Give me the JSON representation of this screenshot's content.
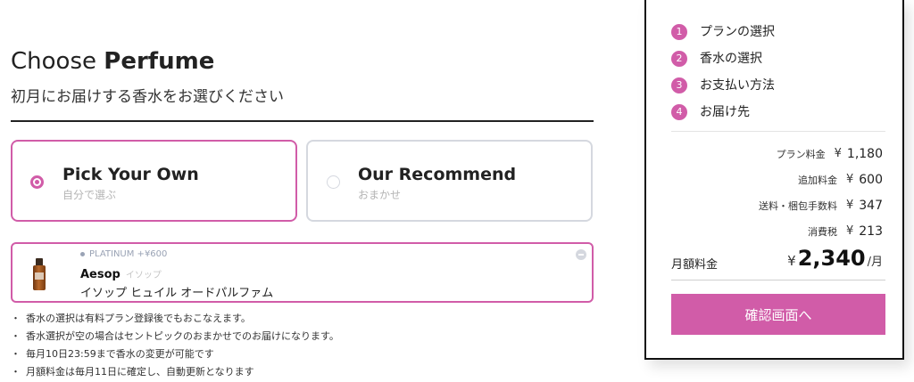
{
  "header": {
    "title_light": "Choose",
    "title_bold": "Perfume",
    "subtitle": "初月にお届けする香水をお選びください"
  },
  "options": [
    {
      "title": "Pick Your Own",
      "subtitle": "自分で選ぶ",
      "selected": true
    },
    {
      "title": "Our Recommend",
      "subtitle": "おまかせ",
      "selected": false
    }
  ],
  "product": {
    "tier": "PLATINUM +¥600",
    "brand": "Aesop",
    "brand_kana": "イソップ",
    "name": "イソップ ヒュイル オードパルファム"
  },
  "notes": [
    "香水の選択は有料プラン登録後でもおこなえます。",
    "香水選択が空の場合はセントピックのおまかせでのお届けになります。",
    "毎月10日23:59まで香水の変更が可能です",
    "月額料金は毎月11日に確定し、自動更新となります"
  ],
  "steps": [
    {
      "num": "1",
      "label": "プランの選択"
    },
    {
      "num": "2",
      "label": "香水の選択"
    },
    {
      "num": "3",
      "label": "お支払い方法"
    },
    {
      "num": "4",
      "label": "お届け先"
    }
  ],
  "fees": [
    {
      "label": "プラン料金",
      "yen": "¥",
      "value": "1,180"
    },
    {
      "label": "追加料金",
      "yen": "¥",
      "value": "600"
    },
    {
      "label": "送料・梱包手数料",
      "yen": "¥",
      "value": "347"
    },
    {
      "label": "消費税",
      "yen": "¥",
      "value": "213"
    }
  ],
  "monthly": {
    "label": "月額料金",
    "yen": "¥",
    "amount": "2,340",
    "per": "/月"
  },
  "confirm_label": "確認画面へ",
  "colors": {
    "accent": "#d15ca8",
    "border_gray": "#d5d8df",
    "tier_gray": "#9aa3b5"
  }
}
